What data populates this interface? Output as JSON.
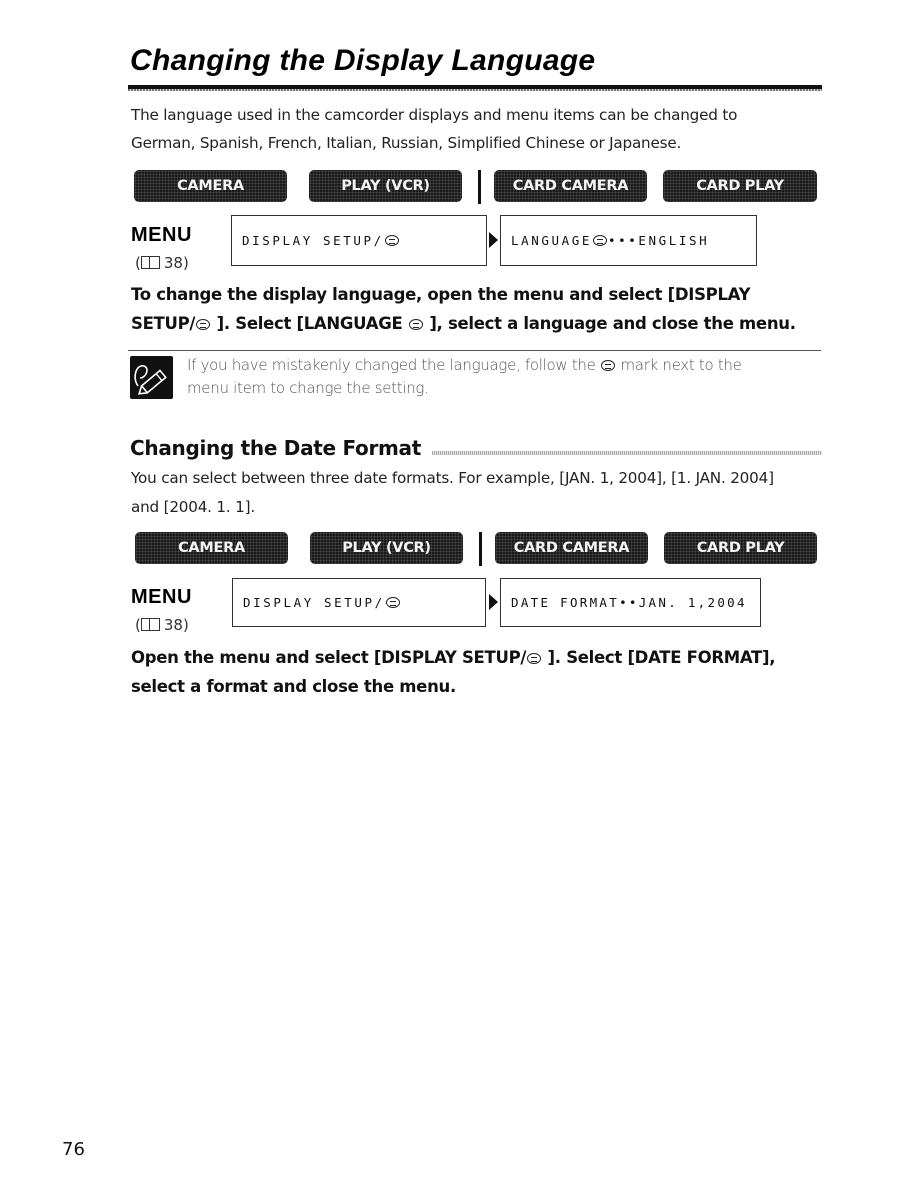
{
  "page": {
    "title": "Changing the Display Language",
    "intro": [
      "The language used in the camcorder displays and menu items can be changed to",
      "German, Spanish, French, Italian, Russian, Simplified Chinese or Japanese."
    ],
    "modes": [
      "CAMERA",
      "PLAY (VCR)",
      "CARD CAMERA",
      "CARD PLAY"
    ],
    "menu_label": "MENU",
    "menu_ref": "38)",
    "menu_ref_open": "(",
    "language_menu": {
      "left": "DISPLAY SETUP/",
      "right_prefix": "LANGUAGE",
      "right_suffix": "•••ENGLISH"
    },
    "instruction_lines": [
      {
        "before": "To change the display language, open the menu and select [DISPLAY",
        "after": ""
      },
      {
        "before": "SETUP/",
        "mid": " ]. Select [LANGUAGE ",
        "after": " ], select a language and close the menu."
      }
    ],
    "note": {
      "line1_before": "If you have mistakenly changed the language, follow the ",
      "line1_after": " mark next to the",
      "line2": "menu item to change the setting."
    },
    "date_section": {
      "heading": "Changing the Date Format",
      "body": [
        "You can select between three date formats. For example, [JAN. 1, 2004], [1. JAN. 2004]",
        "and [2004. 1. 1]."
      ],
      "menu_left": "DISPLAY SETUP/",
      "menu_right": "DATE FORMAT••JAN. 1,2004",
      "instruction_line1_before": "Open the menu and select [DISPLAY SETUP/",
      "instruction_line1_after": " ]. Select [DATE FORMAT],",
      "instruction_line2": "select a format and close the menu."
    },
    "page_number": "76"
  }
}
